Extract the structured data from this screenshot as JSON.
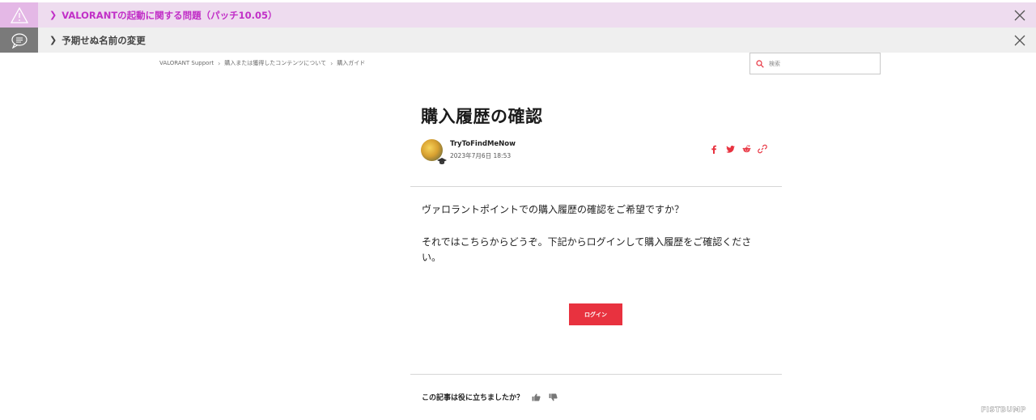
{
  "banners": [
    {
      "text": "VALORANTの起動に関する問題（パッチ10.05）",
      "icon": "warning-icon",
      "color": "#c12fc7"
    },
    {
      "text": "予期せぬ名前の変更",
      "icon": "chat-bubble-icon",
      "color": "#444444"
    }
  ],
  "breadcrumb": {
    "items": [
      "VALORANT Support",
      "購入または獲得したコンテンツについて",
      "購入ガイド"
    ]
  },
  "search": {
    "placeholder": "検索"
  },
  "article": {
    "title": "購入履歴の確認",
    "author": "TryToFindMeNow",
    "date": "2023年7月6日 18:53",
    "paragraph1": "ヴァロラントポイントでの購入履歴の確認をご希望ですか？",
    "paragraph2": "それではこちらからどうぞ。下記からログインして購入履歴をご確認ください。",
    "login_label": "ログイン"
  },
  "share": {
    "icons": [
      "facebook-icon",
      "twitter-icon",
      "reddit-icon",
      "link-icon"
    ]
  },
  "feedback": {
    "question": "この記事は役に立ちましたか？"
  },
  "watermark": "FISTBUMP",
  "colors": {
    "accent": "#e8323f",
    "banner_alert_bg": "#eedcef",
    "banner_neutral_bg": "#efefef"
  }
}
